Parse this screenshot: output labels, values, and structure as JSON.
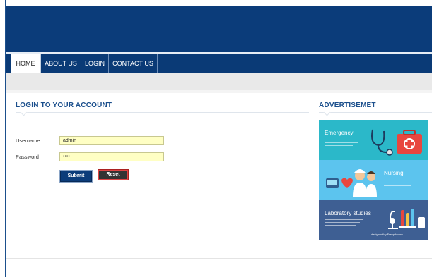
{
  "nav": {
    "items": [
      {
        "label": "HOME",
        "active": true
      },
      {
        "label": "ABOUT US",
        "active": false
      },
      {
        "label": "LOGIN",
        "active": false
      },
      {
        "label": "CONTACT US",
        "active": false
      }
    ]
  },
  "login": {
    "title": "LOGIN TO YOUR ACCOUNT",
    "username_label": "Username",
    "username_value": "admin",
    "password_label": "Password",
    "password_value": "••••",
    "submit_label": "Submit",
    "reset_label": "Reset"
  },
  "ad": {
    "title": "ADVERTISEMET",
    "panels": [
      {
        "label": "Emergency",
        "color": "#2bb8c9"
      },
      {
        "label": "Nursing",
        "color": "#5cc4ee"
      },
      {
        "label": "Laboratory studies",
        "color": "#3e5f93"
      }
    ],
    "credit": "designed by Freepik.com"
  },
  "colors": {
    "header": "#0b3c7a",
    "accent_title": "#1b4f8c",
    "field_bg": "#ffffc4"
  }
}
